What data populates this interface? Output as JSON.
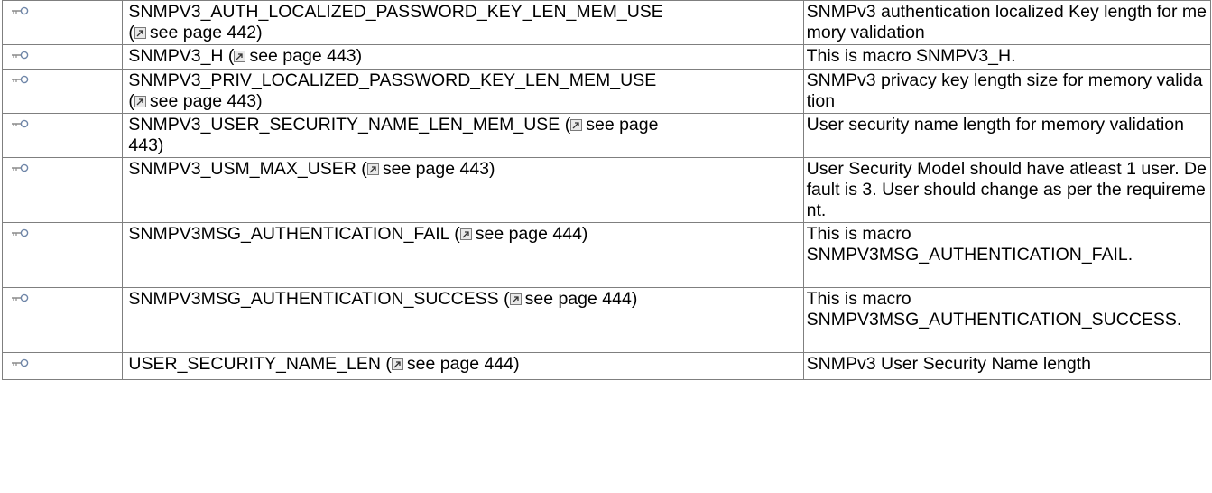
{
  "rows": [
    {
      "name": "SNMPV3_AUTH_LOCALIZED_PASSWORD_KEY_LEN_MEM_USE",
      "sep": "\n(",
      "ref": "see page 442",
      "close": ")",
      "desc": "SNMPv3 authentication localized Key length for memory validation"
    },
    {
      "name": "SNMPV3_H",
      "sep": " (",
      "ref": "see page 443",
      "close": ")",
      "desc": "This is macro SNMPV3_H."
    },
    {
      "name": "SNMPV3_PRIV_LOCALIZED_PASSWORD_KEY_LEN_MEM_USE",
      "sep": "\n(",
      "ref": "see page 443",
      "close": ")",
      "desc": "SNMPv3 privacy key length size for memory validation"
    },
    {
      "name": "SNMPV3_USER_SECURITY_NAME_LEN_MEM_USE",
      "sep": " (",
      "ref": "see page",
      "close": "\n443)",
      "desc": "User security name length for memory validation"
    },
    {
      "name": "SNMPV3_USM_MAX_USER",
      "sep": " (",
      "ref": "see page 443",
      "close": ")",
      "desc": "User Security Model should have atleast 1 user. Default is 3. User should change as per the requirement."
    },
    {
      "name": "SNMPV3MSG_AUTHENTICATION_FAIL",
      "sep": " (",
      "ref": "see page 444",
      "close": ")",
      "desc": "This is macro\nSNMPV3MSG_AUTHENTICATION_FAIL."
    },
    {
      "name": "SNMPV3MSG_AUTHENTICATION_SUCCESS",
      "sep": " (",
      "ref": "see page 444",
      "close": ")",
      "desc": "This is macro\nSNMPV3MSG_AUTHENTICATION_SUCCESS."
    },
    {
      "name": "USER_SECURITY_NAME_LEN",
      "sep": " (",
      "ref": "see page 444",
      "close": ")",
      "desc": "SNMPv3 User Security Name length"
    }
  ],
  "icons": {
    "macro": "macro-key-icon",
    "link": "external-link-icon"
  }
}
